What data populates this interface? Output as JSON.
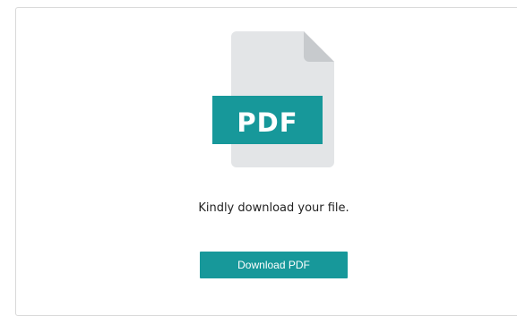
{
  "file_icon": {
    "icon_name": "pdf-file-icon",
    "badge_text": "PDF",
    "badge_color": "#17989a",
    "page_color": "#e3e5e7",
    "fold_color": "#c7cacd"
  },
  "message": "Kindly download your file.",
  "download_button": {
    "label": "Download PDF",
    "color": "#17989a"
  }
}
